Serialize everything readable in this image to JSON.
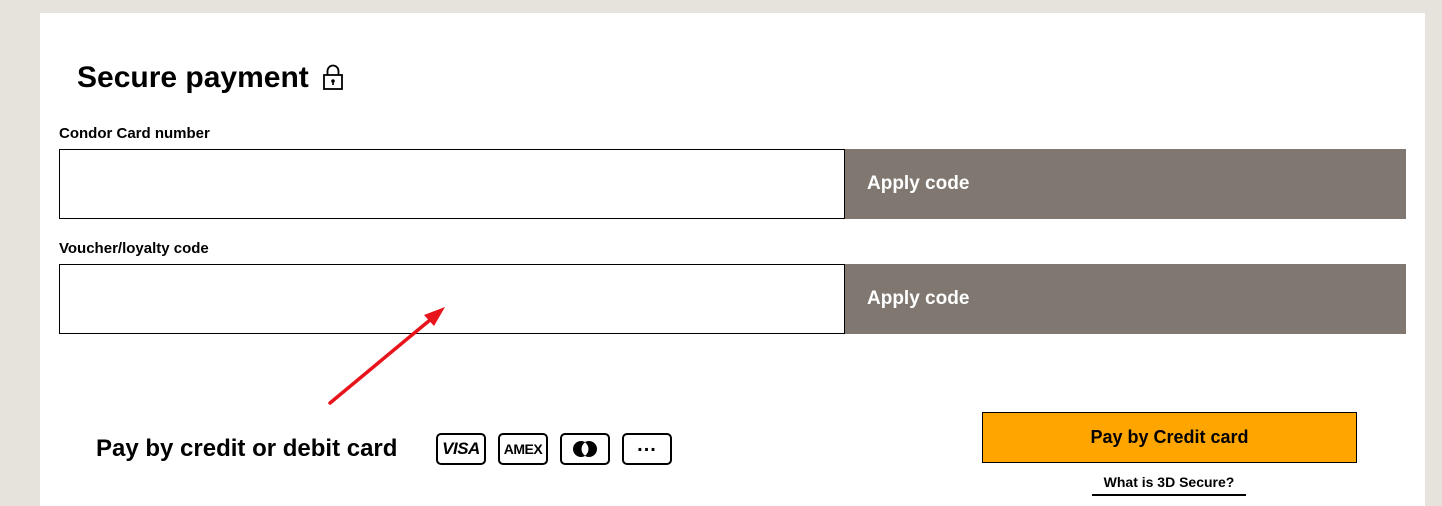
{
  "header": {
    "title": "Secure payment",
    "title_icon": "lock-icon"
  },
  "condor_card": {
    "label": "Condor Card number",
    "value": "",
    "placeholder": "",
    "button_label": "Apply code"
  },
  "voucher": {
    "label": "Voucher/loyalty code",
    "value": "",
    "placeholder": "",
    "button_label": "Apply code"
  },
  "payment": {
    "title": "Pay by credit or debit card",
    "cards": [
      {
        "name": "visa-logo",
        "label": "VISA"
      },
      {
        "name": "amex-logo",
        "label": "AMEX"
      },
      {
        "name": "mastercard-logo",
        "label": ""
      },
      {
        "name": "more-cards-icon",
        "label": "..."
      }
    ],
    "pay_button_label": "Pay by Credit card",
    "secure_link_label": "What is 3D Secure?"
  },
  "colors": {
    "page_background": "#e6e3dc",
    "panel_background": "#ffffff",
    "apply_button": "#7f7770",
    "pay_button": "#ffa500",
    "annotation_arrow": "#e8141b"
  }
}
